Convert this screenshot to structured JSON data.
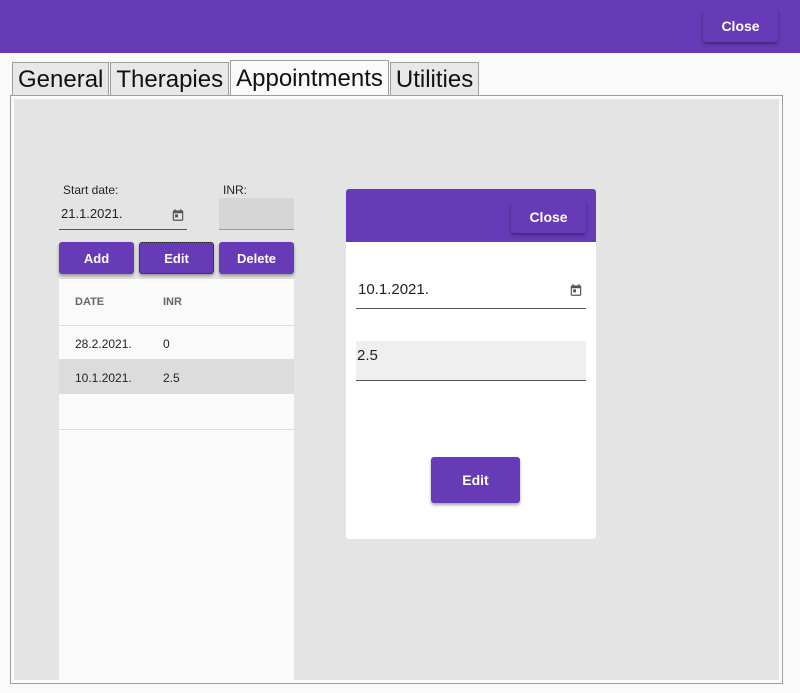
{
  "header": {
    "close_label": "Close"
  },
  "tabs": [
    {
      "label": "General"
    },
    {
      "label": "Therapies"
    },
    {
      "label": "Appointments"
    },
    {
      "label": "Utilities"
    }
  ],
  "active_tab": "Appointments",
  "form": {
    "start_date_label": "Start date:",
    "start_date_value": "21.1.2021.",
    "inr_label": "INR:",
    "inr_value": ""
  },
  "actions": {
    "add": "Add",
    "edit": "Edit",
    "delete": "Delete"
  },
  "table": {
    "columns": [
      "DATE",
      "INR"
    ],
    "rows": [
      {
        "date": "28.2.2021.",
        "inr": "0"
      },
      {
        "date": "10.1.2021.",
        "inr": "2.5",
        "selected": true
      }
    ]
  },
  "dialog": {
    "close_label": "Close",
    "date_value": "10.1.2021.",
    "inr_value": "2.5",
    "edit_label": "Edit"
  },
  "colors": {
    "accent": "#673ab7",
    "panel": "#e4e4e4",
    "selected_row": "#dcdcdc"
  },
  "icons": [
    "calendar-icon"
  ]
}
